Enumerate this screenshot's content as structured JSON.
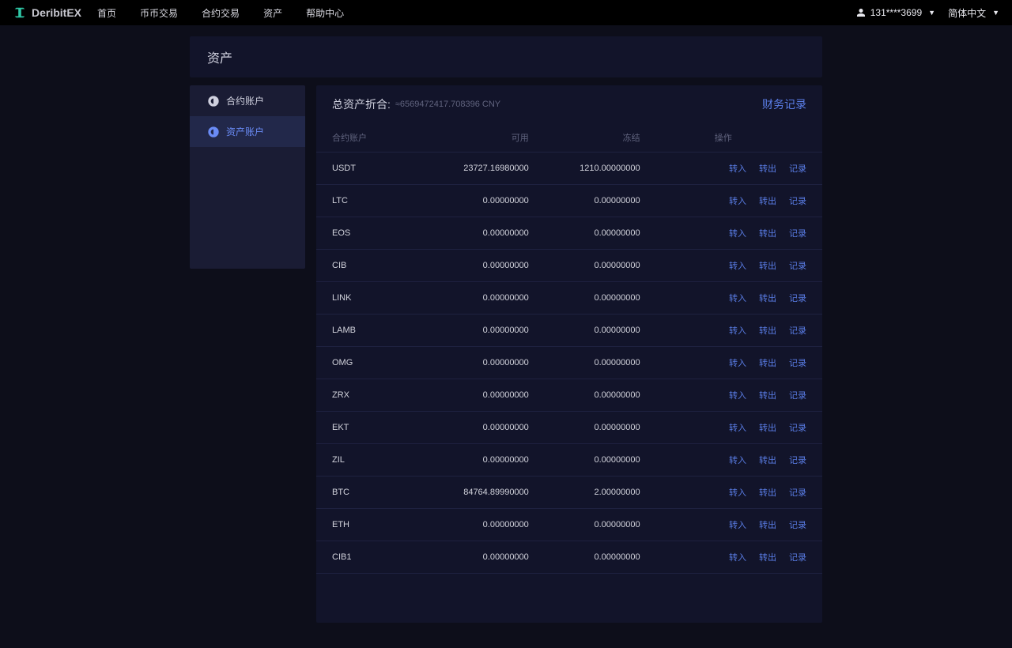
{
  "brand": {
    "name": "DeribitEX"
  },
  "nav": {
    "items": [
      "首页",
      "币币交易",
      "合约交易",
      "资产",
      "帮助中心"
    ]
  },
  "user": {
    "display": "131****3699"
  },
  "lang": {
    "display": "简体中文"
  },
  "page_title": "资产",
  "sidebar": {
    "items": [
      {
        "label": "合约账户",
        "active": false
      },
      {
        "label": "资产账户",
        "active": true
      }
    ]
  },
  "summary": {
    "label": "总资产折合:",
    "amount": "≈6569472417.708396 CNY",
    "link": "财务记录"
  },
  "table": {
    "headers": {
      "coin": "合约账户",
      "available": "可用",
      "frozen": "冻结",
      "ops": "操作"
    },
    "ops_labels": {
      "in": "转入",
      "out": "转出",
      "rec": "记录"
    },
    "rows": [
      {
        "coin": "USDT",
        "available": "23727.16980000",
        "frozen": "1210.00000000"
      },
      {
        "coin": "LTC",
        "available": "0.00000000",
        "frozen": "0.00000000"
      },
      {
        "coin": "EOS",
        "available": "0.00000000",
        "frozen": "0.00000000"
      },
      {
        "coin": "CIB",
        "available": "0.00000000",
        "frozen": "0.00000000"
      },
      {
        "coin": "LINK",
        "available": "0.00000000",
        "frozen": "0.00000000"
      },
      {
        "coin": "LAMB",
        "available": "0.00000000",
        "frozen": "0.00000000"
      },
      {
        "coin": "OMG",
        "available": "0.00000000",
        "frozen": "0.00000000"
      },
      {
        "coin": "ZRX",
        "available": "0.00000000",
        "frozen": "0.00000000"
      },
      {
        "coin": "EKT",
        "available": "0.00000000",
        "frozen": "0.00000000"
      },
      {
        "coin": "ZIL",
        "available": "0.00000000",
        "frozen": "0.00000000"
      },
      {
        "coin": "BTC",
        "available": "84764.89990000",
        "frozen": "2.00000000"
      },
      {
        "coin": "ETH",
        "available": "0.00000000",
        "frozen": "0.00000000"
      },
      {
        "coin": "CIB1",
        "available": "0.00000000",
        "frozen": "0.00000000"
      }
    ]
  }
}
